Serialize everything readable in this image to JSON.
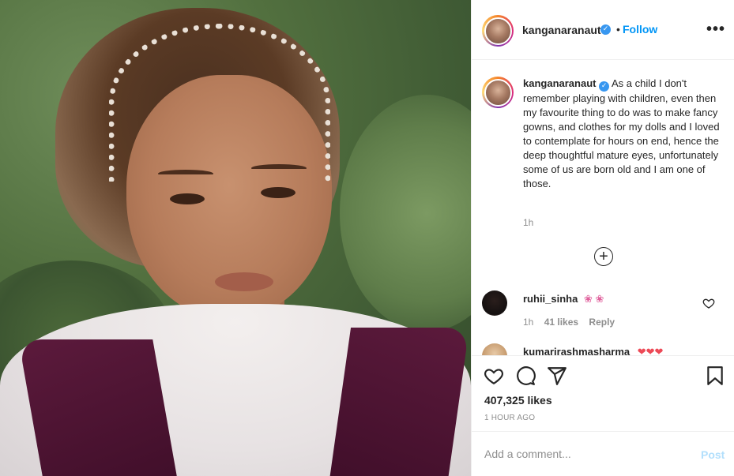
{
  "post": {
    "username": "kanganaranaut",
    "follow_label": "Follow",
    "dot": "•",
    "more_label": "•••",
    "verified_icon": "verified-badge-icon"
  },
  "caption": {
    "username": "kanganaranaut",
    "text": "As a child I don't remember playing with children, even then my favourite thing to do was to make fancy gowns, and clothes for my dolls and I loved to contemplate for hours on end, hence the deep thoughtful mature eyes, unfortunately some of us are born old and I am one of those.",
    "time": "1h"
  },
  "load_more": "+",
  "comments": [
    {
      "username": "ruhii_sinha",
      "emoji": "❀ ❀",
      "time": "1h",
      "likes": "41 likes",
      "reply": "Reply"
    },
    {
      "username": "kumarirashmasharma",
      "emoji": "❤❤❤"
    }
  ],
  "actions": {
    "likes": "407,325 likes",
    "time_ago": "1 HOUR AGO"
  },
  "add_comment": {
    "placeholder": "Add a comment...",
    "post_label": "Post"
  },
  "colors": {
    "link": "#0095f6",
    "verified": "#3897f0",
    "post_disabled": "#b2dffc",
    "heart_red": "#ed4956"
  }
}
